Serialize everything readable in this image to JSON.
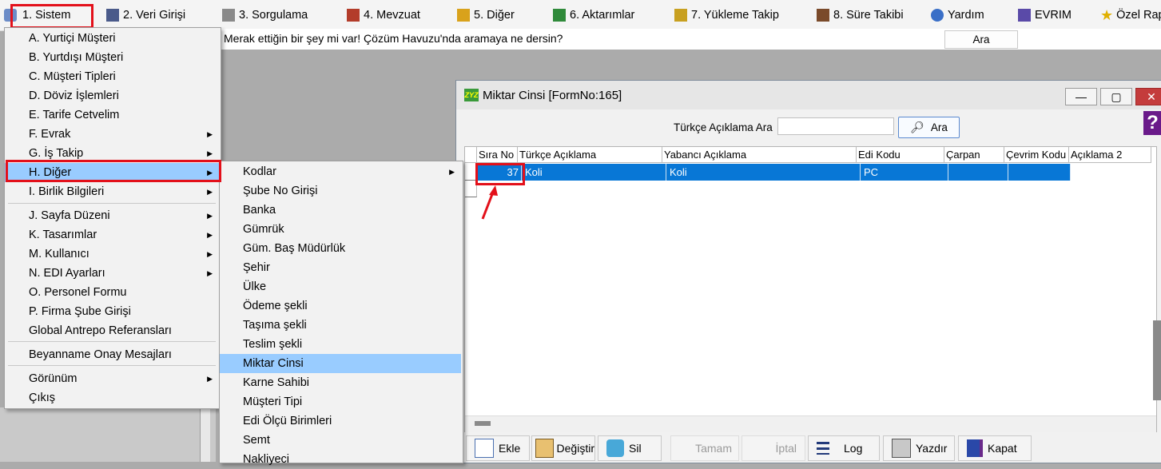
{
  "menubar": {
    "items": [
      {
        "label": "1.  Sistem"
      },
      {
        "label": "2.  Veri Girişi"
      },
      {
        "label": "3.  Sorgulama"
      },
      {
        "label": "4.  Mevzuat"
      },
      {
        "label": "5.  Diğer"
      },
      {
        "label": "6.  Aktarımlar"
      },
      {
        "label": "7.  Yükleme Takip"
      },
      {
        "label": "8. Süre Takibi"
      },
      {
        "label": "Yardım"
      },
      {
        "label": "EVRIM"
      },
      {
        "label": "Özel Rap"
      }
    ]
  },
  "search": {
    "text": "Merak ettiğin bir şey mi var! Çözüm Havuzu'nda aramaya ne dersin?",
    "button": "Ara"
  },
  "sistem_menu": {
    "items": [
      {
        "label": "A.  Yurtiçi Müşteri"
      },
      {
        "label": "B.  Yurtdışı Müşteri"
      },
      {
        "label": "C.  Müşteri Tipleri"
      },
      {
        "label": "D.   Döviz İşlemleri"
      },
      {
        "label": "E.   Tarife Cetvelim"
      },
      {
        "label": "F.   Evrak"
      },
      {
        "label": "G.  İş Takip"
      },
      {
        "label": "H.  Diğer"
      },
      {
        "label": "I.   Birlik Bilgileri"
      },
      {
        "label": "J.  Sayfa Düzeni"
      },
      {
        "label": "K.  Tasarımlar"
      },
      {
        "label": "M.   Kullanıcı"
      },
      {
        "label": "N.  EDI Ayarları"
      },
      {
        "label": "O.   Personel Formu"
      },
      {
        "label": "P.   Firma Şube Girişi"
      },
      {
        "label": "Global Antrepo Referansları"
      },
      {
        "label": "Beyanname Onay Mesajları"
      },
      {
        "label": "Görünüm"
      },
      {
        "label": "Çıkış"
      }
    ]
  },
  "diger_submenu": {
    "items": [
      {
        "label": "Kodlar"
      },
      {
        "label": "Şube No Girişi"
      },
      {
        "label": "Banka"
      },
      {
        "label": "Gümrük"
      },
      {
        "label": "Güm. Baş Müdürlük"
      },
      {
        "label": "Şehir"
      },
      {
        "label": "Ülke"
      },
      {
        "label": "Ödeme şekli"
      },
      {
        "label": "Taşıma şekli"
      },
      {
        "label": "Teslim şekli"
      },
      {
        "label": "Miktar Cinsi"
      },
      {
        "label": "Karne Sahibi"
      },
      {
        "label": "Müşteri  Tipi"
      },
      {
        "label": "Edi Ölçü Birimleri"
      },
      {
        "label": "Semt"
      },
      {
        "label": "Nakliyeci"
      }
    ]
  },
  "form": {
    "title": "Miktar Cinsi [FormNo:165]",
    "search_label": "Türkçe Açıklama Ara",
    "search_value": "",
    "search_button": "Ara",
    "columns": [
      "Sıra No",
      "Türkçe Açıklama",
      "Yabancı Açıklama",
      "Edi Kodu",
      "Çarpan",
      "Çevrim Kodu",
      "Açıklama 2"
    ],
    "rows": [
      {
        "sira_no": "37",
        "turkce": "Koli",
        "yabanci": "Koli",
        "edi": "PC",
        "carpan": "",
        "cevrim": ""
      }
    ],
    "buttons": {
      "ekle": "Ekle",
      "degistir": "Değiştir",
      "sil": "Sil",
      "tamam": "Tamam",
      "iptal": "İptal",
      "log": "Log",
      "yazdir": "Yazdır",
      "kapat": "Kapat"
    }
  },
  "colors": {
    "highlight_red": "#e3101a",
    "selection_blue": "#0877d6",
    "menu_hover": "#99ccff"
  }
}
